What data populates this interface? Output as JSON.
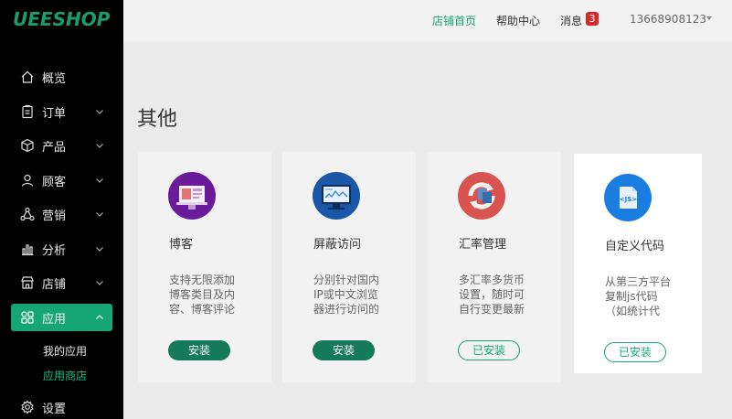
{
  "sidebar": {
    "logo": "UEESHOP",
    "items": [
      {
        "label": "概览"
      },
      {
        "label": "订单"
      },
      {
        "label": "产品"
      },
      {
        "label": "顾客"
      },
      {
        "label": "营销"
      },
      {
        "label": "分析"
      },
      {
        "label": "店铺"
      },
      {
        "label": "应用"
      },
      {
        "label": "设置"
      }
    ],
    "sub_items": [
      {
        "label": "我的应用"
      },
      {
        "label": "应用商店"
      }
    ]
  },
  "topbar": {
    "store_home": "店铺首页",
    "help_center": "帮助中心",
    "messages": "消息",
    "message_count": "3",
    "account": "13668908123"
  },
  "main": {
    "section_title": "其他",
    "cards": [
      {
        "name": "博客",
        "desc": "支持无限添加博客类目及内容、博客评论",
        "button": "安装",
        "icon": "blog-icon",
        "color": "#6a1b9a"
      },
      {
        "name": "屏蔽访问",
        "desc": "分别针对国内IP或中文浏览器进行访问的",
        "button": "安装",
        "icon": "block-access-icon",
        "color": "#1b57a8"
      },
      {
        "name": "汇率管理",
        "desc": "多汇率多货币设置，随时可自行变更最新",
        "button": "已安装",
        "icon": "exchange-rate-icon",
        "color": "#d9534f"
      },
      {
        "name": "自定义代码",
        "desc": "从第三方平台复制js代码（如统计代",
        "button": "已安装",
        "icon": "code-js-icon",
        "color": "#1a7de0"
      }
    ]
  }
}
